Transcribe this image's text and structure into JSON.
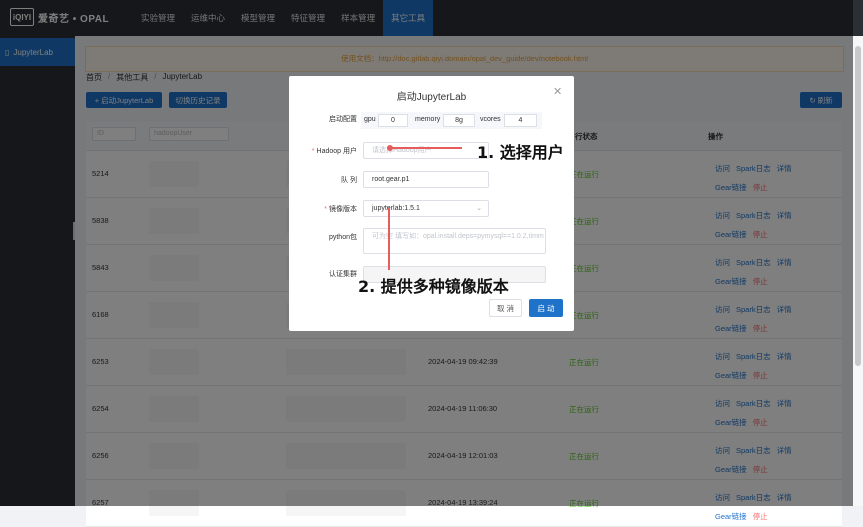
{
  "brand": {
    "logo_mark": "iQIYI",
    "text": "爱奇艺 • OPAL"
  },
  "nav": [
    "实验管理",
    "运维中心",
    "模型管理",
    "特征管理",
    "样本管理",
    "其它工具"
  ],
  "sidebar": {
    "item": "JupyterLab"
  },
  "doc_banner": "使用文档：http://doc.gitlab.qiyi.domain/opal_dev_guide/dev/notebook.html",
  "breadcrumb": [
    "首页",
    "其他工具",
    "JupyterLab"
  ],
  "buttons": {
    "start": "+ 启动JupyterLab",
    "history": "切换历史记录",
    "refresh": "↻ 刷新"
  },
  "filters": {
    "id_placeholder": "ID",
    "user_placeholder": "hadoopUser"
  },
  "table": {
    "headers": {
      "status": "行状态",
      "ops": "操作"
    },
    "rows": [
      {
        "id": "5214",
        "time": "",
        "status": "正在运行"
      },
      {
        "id": "5838",
        "time": "",
        "status": "正在运行"
      },
      {
        "id": "5843",
        "time": "",
        "status": "正在运行"
      },
      {
        "id": "6168",
        "time": "",
        "status": "正在运行"
      },
      {
        "id": "6253",
        "time": "2024-04-19 09:42:39",
        "status": "正在运行"
      },
      {
        "id": "6254",
        "time": "2024-04-19 11:06:30",
        "status": "正在运行"
      },
      {
        "id": "6256",
        "time": "2024-04-19 12:01:03",
        "status": "正在运行"
      },
      {
        "id": "6257",
        "time": "2024-04-19 13:39:24",
        "status": "正在运行"
      }
    ],
    "ops": {
      "visit": "访问",
      "spark_log": "Spark日志",
      "detail": "详情",
      "gear_link": "Gear链接",
      "stop": "停止"
    }
  },
  "modal": {
    "title": "启动JupyterLab",
    "labels": {
      "config": "启动配置",
      "hadoop_user": "Hadoop 用户",
      "queue": "队 列",
      "image": "镜像版本",
      "python": "python包",
      "auth": "认证集群"
    },
    "config": {
      "gpu_label": "gpu",
      "gpu": "0",
      "memory_label": "memory",
      "memory": "8g",
      "vcores_label": "vcores",
      "vcores": "4"
    },
    "hadoop_placeholder": "请选择Hadoop用户",
    "queue_value": "root.gear.p1",
    "image_value": "jupyterlab:1.5.1",
    "python_placeholder": "可为空 填写如：opal.install.deps=pymysql==1.0.2,timm",
    "cancel": "取 消",
    "submit": "启 动"
  },
  "annotations": {
    "step1": "1. 选择用户",
    "step2": "2. 提供多种镜像版本"
  }
}
